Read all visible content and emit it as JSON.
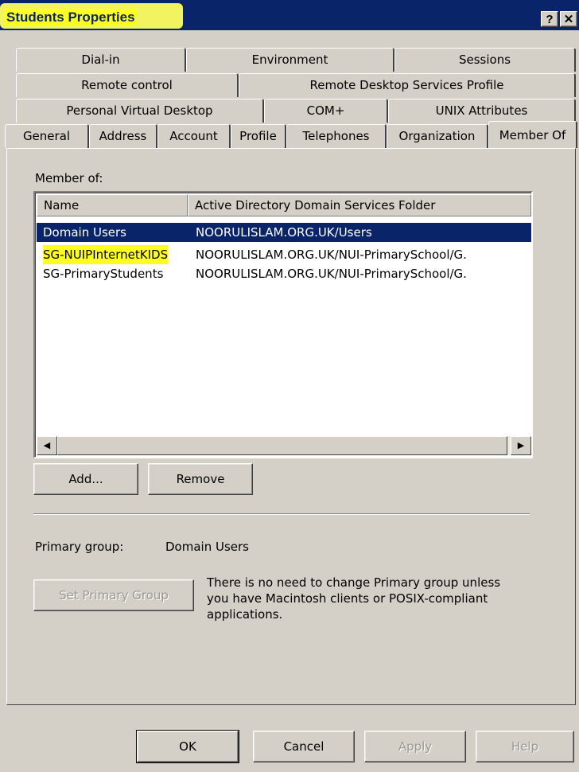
{
  "window": {
    "title": "Students Properties",
    "help_glyph": "?",
    "close_glyph": "✕"
  },
  "tabs_row1": [
    "Dial-in",
    "Environment",
    "Sessions"
  ],
  "tabs_row2": [
    "Remote control",
    "Remote Desktop Services Profile"
  ],
  "tabs_row3": [
    "Personal Virtual Desktop",
    "COM+",
    "UNIX Attributes"
  ],
  "tabs_row4": [
    "General",
    "Address",
    "Account",
    "Profile",
    "Telephones",
    "Organization",
    "Member Of"
  ],
  "member_of": {
    "label": "Member of:",
    "columns": [
      "Name",
      "Active Directory Domain Services Folder"
    ],
    "rows": [
      {
        "name": "Domain Users",
        "folder": "NOORULISLAM.ORG.UK/Users"
      },
      {
        "name": "SG-NUIPInternetKIDS",
        "folder": "NOORULISLAM.ORG.UK/NUI-PrimarySchool/G."
      },
      {
        "name": "SG-PrimaryStudents",
        "folder": "NOORULISLAM.ORG.UK/NUI-PrimarySchool/G."
      }
    ],
    "scroll_left_glyph": "◀",
    "scroll_right_glyph": "▶"
  },
  "buttons": {
    "add": "Add...",
    "remove": "Remove"
  },
  "primary_group": {
    "label": "Primary group:",
    "value": "Domain Users",
    "set_button": "Set Primary Group",
    "note_line1": "There is no need to change Primary group unless",
    "note_line2": "you have Macintosh clients or POSIX-compliant",
    "note_line3": "applications."
  },
  "footer": {
    "ok": "OK",
    "cancel": "Cancel",
    "apply": "Apply",
    "help": "Help"
  },
  "colors": {
    "titlebar": "#0a246a",
    "highlight": "#ffff1f",
    "face": "#d4d0c8",
    "selection": "#0a246a"
  }
}
